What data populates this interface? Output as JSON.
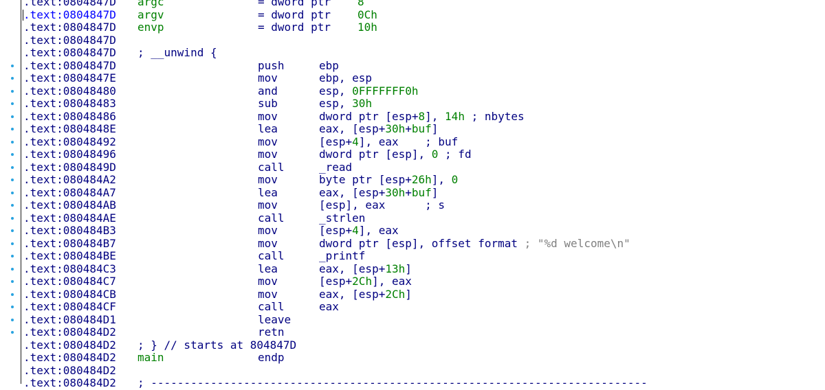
{
  "lines": [
    {
      "kind": "var",
      "dot": false,
      "addr": ".text:0804847D",
      "name": "argc",
      "eq": "= dword ptr",
      "val": "8"
    },
    {
      "kind": "var",
      "dot": false,
      "addr": ".text:0804847D",
      "name": "argv",
      "eq": "= dword ptr",
      "val": "0Ch",
      "cursor": true
    },
    {
      "kind": "var",
      "dot": false,
      "addr": ".text:0804847D",
      "name": "envp",
      "eq": "= dword ptr",
      "val": "10h"
    },
    {
      "kind": "blank",
      "dot": false,
      "addr": ".text:0804847D"
    },
    {
      "kind": "comment",
      "dot": false,
      "addr": ".text:0804847D",
      "comment": "; __unwind {"
    },
    {
      "kind": "insn",
      "dot": true,
      "addr": ".text:0804847D",
      "mn": "push",
      "op": [
        [
          "ebp",
          "b"
        ]
      ]
    },
    {
      "kind": "insn",
      "dot": true,
      "addr": ".text:0804847E",
      "mn": "mov",
      "op": [
        [
          "ebp, esp",
          "b"
        ]
      ]
    },
    {
      "kind": "insn",
      "dot": true,
      "addr": ".text:08048480",
      "mn": "and",
      "op": [
        [
          "esp, ",
          "b"
        ],
        [
          "0FFFFFFF0h",
          "g"
        ]
      ]
    },
    {
      "kind": "insn",
      "dot": true,
      "addr": ".text:08048483",
      "mn": "sub",
      "op": [
        [
          "esp, ",
          "b"
        ],
        [
          "30h",
          "g"
        ]
      ]
    },
    {
      "kind": "insn",
      "dot": true,
      "addr": ".text:08048486",
      "mn": "mov",
      "op": [
        [
          "dword ptr [esp+",
          "b"
        ],
        [
          "8",
          "g"
        ],
        [
          "], ",
          "b"
        ],
        [
          "14h",
          "g"
        ],
        [
          " ; nbytes",
          "b"
        ]
      ]
    },
    {
      "kind": "insn",
      "dot": true,
      "addr": ".text:0804848E",
      "mn": "lea",
      "op": [
        [
          "eax, [esp+",
          "b"
        ],
        [
          "30h",
          "g"
        ],
        [
          "+",
          "b"
        ],
        [
          "buf",
          "g"
        ],
        [
          "]",
          "b"
        ]
      ]
    },
    {
      "kind": "insn",
      "dot": true,
      "addr": ".text:08048492",
      "mn": "mov",
      "op": [
        [
          "[esp+",
          "b"
        ],
        [
          "4",
          "g"
        ],
        [
          "], eax    ; buf",
          "b"
        ]
      ]
    },
    {
      "kind": "insn",
      "dot": true,
      "addr": ".text:08048496",
      "mn": "mov",
      "op": [
        [
          "dword ptr [esp], ",
          "b"
        ],
        [
          "0",
          "g"
        ],
        [
          " ; fd",
          "b"
        ]
      ]
    },
    {
      "kind": "insn",
      "dot": true,
      "addr": ".text:0804849D",
      "mn": "call",
      "op": [
        [
          "_read",
          "b"
        ]
      ]
    },
    {
      "kind": "insn",
      "dot": true,
      "addr": ".text:080484A2",
      "mn": "mov",
      "op": [
        [
          "byte ptr [esp+",
          "b"
        ],
        [
          "26h",
          "g"
        ],
        [
          "], ",
          "b"
        ],
        [
          "0",
          "g"
        ]
      ]
    },
    {
      "kind": "insn",
      "dot": true,
      "addr": ".text:080484A7",
      "mn": "lea",
      "op": [
        [
          "eax, [esp+",
          "b"
        ],
        [
          "30h",
          "g"
        ],
        [
          "+",
          "b"
        ],
        [
          "buf",
          "g"
        ],
        [
          "]",
          "b"
        ]
      ]
    },
    {
      "kind": "insn",
      "dot": true,
      "addr": ".text:080484AB",
      "mn": "mov",
      "op": [
        [
          "[esp], eax      ; s",
          "b"
        ]
      ]
    },
    {
      "kind": "insn",
      "dot": true,
      "addr": ".text:080484AE",
      "mn": "call",
      "op": [
        [
          "_strlen",
          "b"
        ]
      ]
    },
    {
      "kind": "insn",
      "dot": true,
      "addr": ".text:080484B3",
      "mn": "mov",
      "op": [
        [
          "[esp+",
          "b"
        ],
        [
          "4",
          "g"
        ],
        [
          "], eax",
          "b"
        ]
      ]
    },
    {
      "kind": "insn",
      "dot": true,
      "addr": ".text:080484B7",
      "mn": "mov",
      "op": [
        [
          "dword ptr [esp], offset format ",
          "b"
        ],
        [
          "; \"%d welcome\\n\"",
          "x"
        ]
      ]
    },
    {
      "kind": "insn",
      "dot": true,
      "addr": ".text:080484BE",
      "mn": "call",
      "op": [
        [
          "_printf",
          "b"
        ]
      ]
    },
    {
      "kind": "insn",
      "dot": true,
      "addr": ".text:080484C3",
      "mn": "lea",
      "op": [
        [
          "eax, [esp+",
          "b"
        ],
        [
          "13h",
          "g"
        ],
        [
          "]",
          "b"
        ]
      ]
    },
    {
      "kind": "insn",
      "dot": true,
      "addr": ".text:080484C7",
      "mn": "mov",
      "op": [
        [
          "[esp+",
          "b"
        ],
        [
          "2Ch",
          "g"
        ],
        [
          "], eax",
          "b"
        ]
      ]
    },
    {
      "kind": "insn",
      "dot": true,
      "addr": ".text:080484CB",
      "mn": "mov",
      "op": [
        [
          "eax, [esp+",
          "b"
        ],
        [
          "2Ch",
          "g"
        ],
        [
          "]",
          "b"
        ]
      ]
    },
    {
      "kind": "insn",
      "dot": true,
      "addr": ".text:080484CF",
      "mn": "call",
      "op": [
        [
          "eax",
          "b"
        ]
      ]
    },
    {
      "kind": "insn",
      "dot": true,
      "addr": ".text:080484D1",
      "mn": "leave",
      "op": []
    },
    {
      "kind": "insn",
      "dot": true,
      "addr": ".text:080484D2",
      "mn": "retn",
      "op": []
    },
    {
      "kind": "comment",
      "dot": false,
      "addr": ".text:080484D2",
      "comment": "; } // starts at 804847D"
    },
    {
      "kind": "endp",
      "dot": false,
      "addr": ".text:080484D2",
      "name": "main",
      "mn": "endp"
    },
    {
      "kind": "blank",
      "dot": false,
      "addr": ".text:080484D2"
    },
    {
      "kind": "sep",
      "dot": false,
      "addr": ".text:080484D2",
      "comment": "; ---------------------------------------------------------------------------"
    }
  ]
}
